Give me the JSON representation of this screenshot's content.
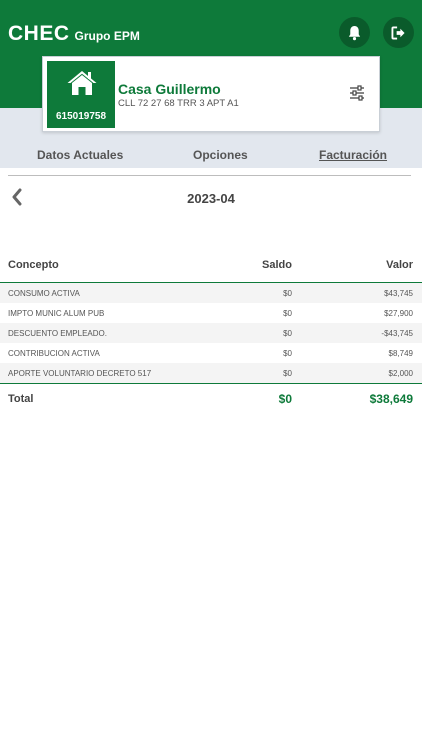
{
  "header": {
    "brand": "CHEC",
    "brand_group": "Grupo EPM",
    "notifications_icon": "bell-icon",
    "logout_icon": "logout-icon"
  },
  "property_card": {
    "account_number": "615019758",
    "name": "Casa Guillermo",
    "address": "CLL 72 27 68 TRR 3 APT A1",
    "icon": "house-icon",
    "settings_icon": "sliders-icon"
  },
  "tabs": [
    {
      "label": "Datos Actuales",
      "active": false
    },
    {
      "label": "Opciones",
      "active": false
    },
    {
      "label": "Facturación",
      "active": true
    }
  ],
  "period": {
    "label": "2023-04",
    "prev_icon": "chevron-left-icon"
  },
  "table": {
    "columns": [
      "Concepto",
      "Saldo",
      "Valor"
    ],
    "rows": [
      {
        "concepto": "CONSUMO ACTIVA",
        "saldo": "$0",
        "valor": "$43,745"
      },
      {
        "concepto": "IMPTO MUNIC ALUM PUB",
        "saldo": "$0",
        "valor": "$27,900"
      },
      {
        "concepto": "DESCUENTO EMPLEADO.",
        "saldo": "$0",
        "valor": "-$43,745"
      },
      {
        "concepto": "CONTRIBUCION ACTIVA",
        "saldo": "$0",
        "valor": "$8,749"
      },
      {
        "concepto": "APORTE VOLUNTARIO DECRETO 517",
        "saldo": "$0",
        "valor": "$2,000"
      }
    ],
    "total": {
      "label": "Total",
      "saldo": "$0",
      "valor": "$38,649"
    }
  },
  "colors": {
    "brand_green": "#0e7a3a",
    "band_gray": "#e2e7ee"
  }
}
